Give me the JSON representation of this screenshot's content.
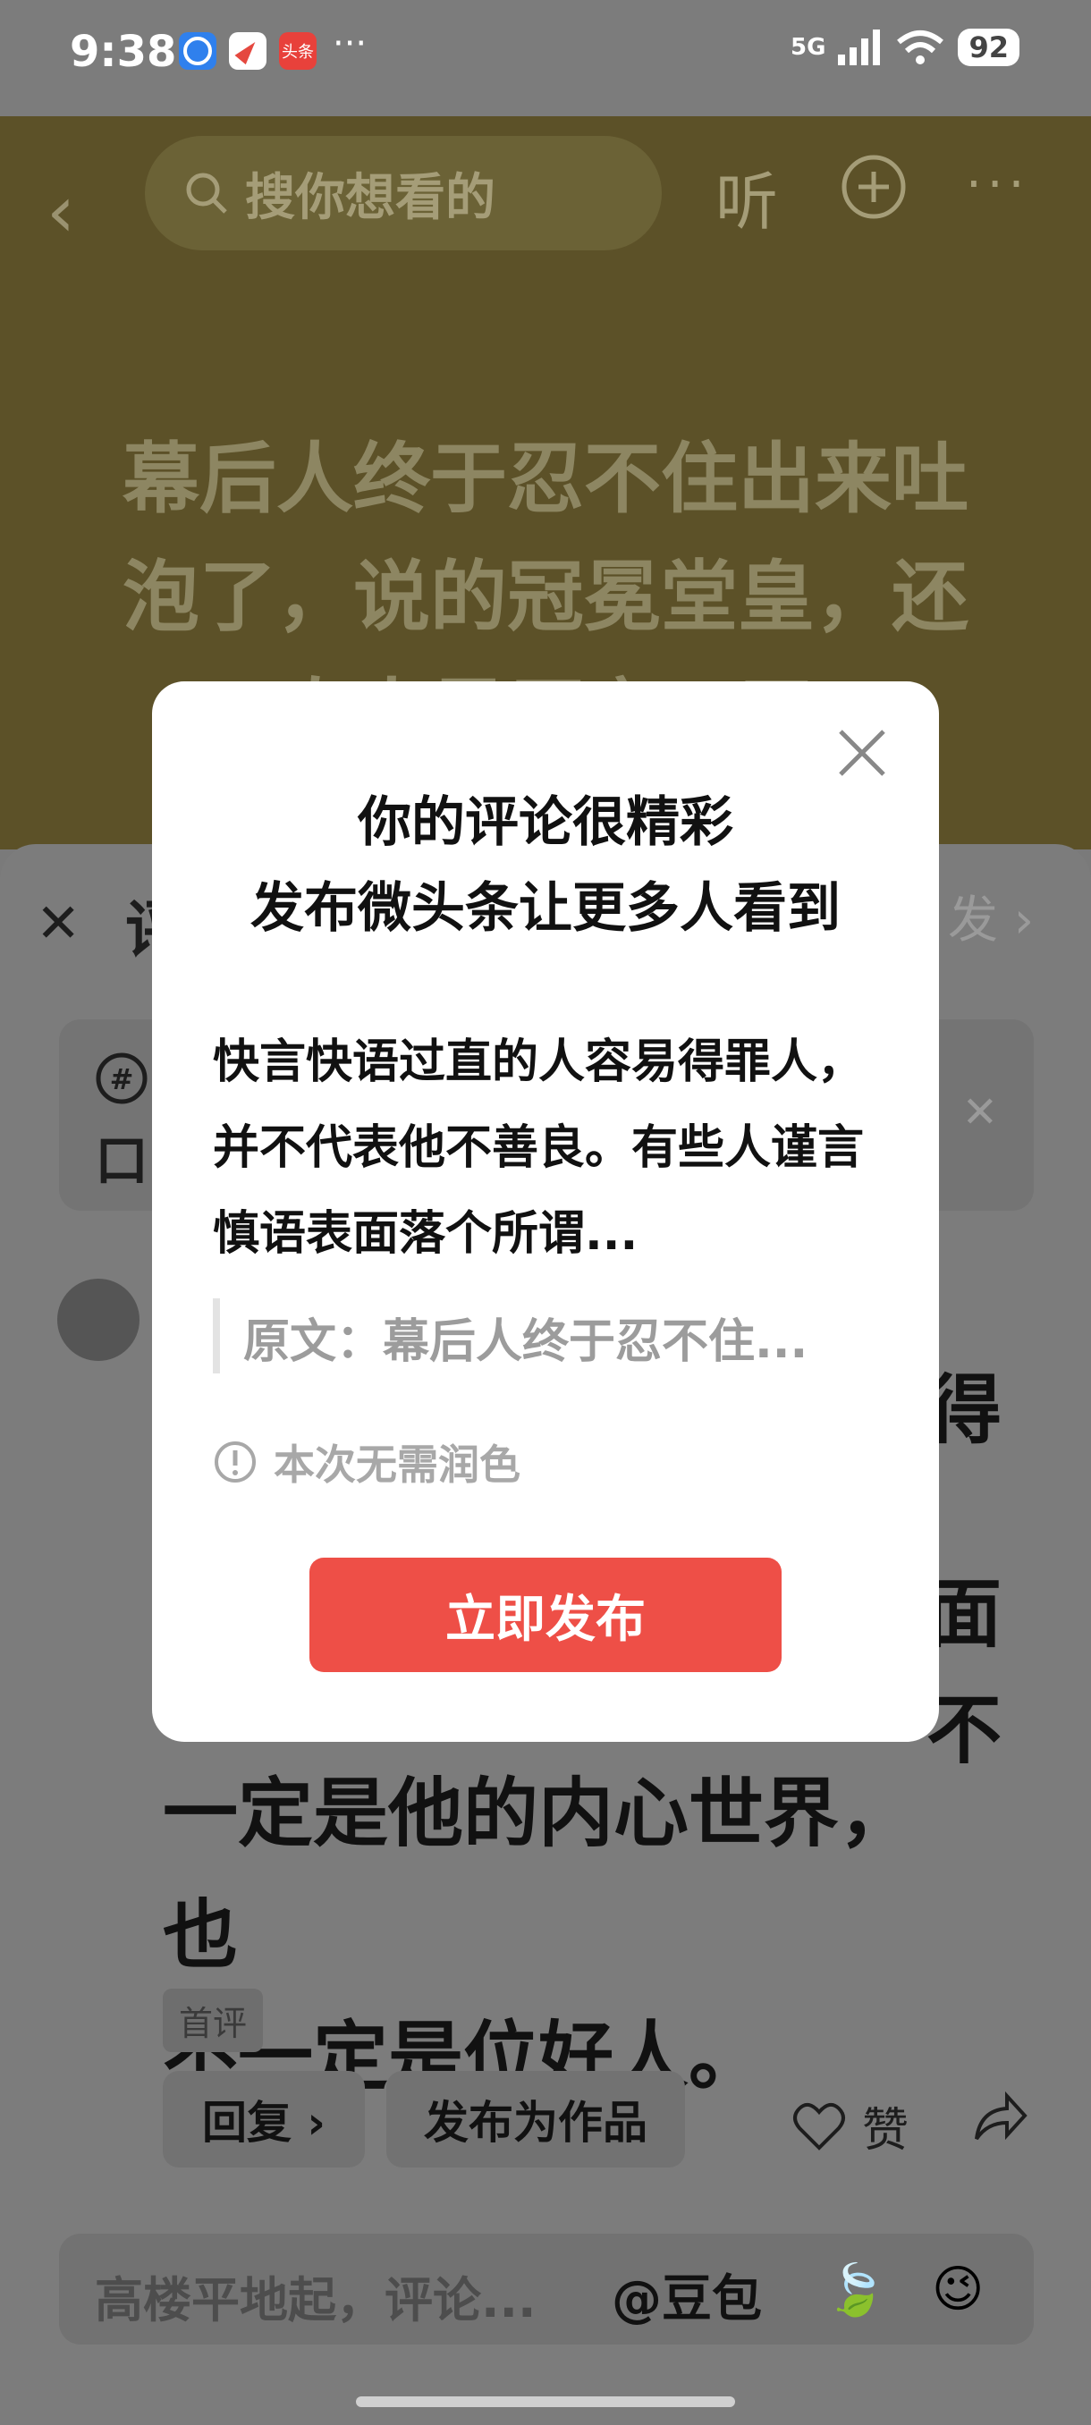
{
  "status_bar": {
    "time": "9:38",
    "network": "5G",
    "battery": "92",
    "more": "···",
    "app_icons": [
      "browser-icon",
      "compass-icon",
      "toutiao-icon"
    ],
    "toutiao_label": "头条"
  },
  "header": {
    "search_placeholder": "搜你想看的",
    "listen_label": "听",
    "more_label": "···"
  },
  "article": {
    "headline": "幕后人终于忍不住出来吐泡了，说的冠冕堂皇，还真人是厉害，无"
  },
  "sheet": {
    "title_fragment": "评",
    "publish_fragment": "发",
    "topic_fragment": "口",
    "comment_text": "",
    "fragments": {
      "de": "得",
      "mian": "面",
      "bu": "不"
    },
    "comment_visible": "一定是他的内心世界，也\n不一定是位好人。",
    "first_comment_badge": "首评",
    "reply_label": "回复 ›",
    "publish_as_work_label": "发布为作品",
    "like_label": "赞",
    "input_placeholder": "高楼平地起，评论...",
    "doubao_label": "@豆包"
  },
  "dialog": {
    "title_line1": "你的评论很精彩",
    "title_line2": "发布微头条让更多人看到",
    "body": "快言快语过直的人容易得罪人，并不代表他不善良。有些人谨言慎语表面落个所谓...",
    "quote": "原文：幕后人终于忍不住...",
    "hint": "本次无需润色",
    "publish_button": "立即发布"
  },
  "colors": {
    "accent_red": "#ee4f47",
    "dim_overlay": "#7a7a7a"
  }
}
